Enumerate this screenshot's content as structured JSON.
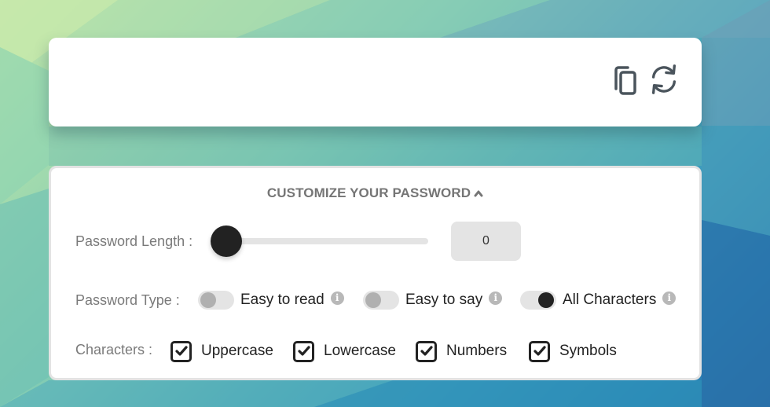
{
  "colors": {
    "accent": "#222222",
    "label": "#7a7a7a",
    "track": "#e4e4e4",
    "card_border": "#e3e3e3",
    "icon": "#4a545c",
    "info_icon": "#b8b8b8"
  },
  "result": {
    "password_value": "",
    "copy_icon": "copy-icon",
    "refresh_icon": "refresh-icon"
  },
  "customize": {
    "title": "CUSTOMIZE YOUR PASSWORD",
    "title_icon": "chevron-up-icon",
    "length": {
      "label": "Password Length :",
      "value": "0",
      "slider_fraction": 0
    },
    "type": {
      "label": "Password Type :",
      "options": [
        {
          "label": "Easy to read",
          "selected": false,
          "info_icon": "info-icon"
        },
        {
          "label": "Easy to say",
          "selected": false,
          "info_icon": "info-icon"
        },
        {
          "label": "All Characters",
          "selected": true,
          "info_icon": "info-icon"
        }
      ]
    },
    "characters": {
      "label": "Characters :",
      "options": [
        {
          "label": "Uppercase",
          "checked": true
        },
        {
          "label": "Lowercase",
          "checked": true
        },
        {
          "label": "Numbers",
          "checked": true
        },
        {
          "label": "Symbols",
          "checked": true
        }
      ]
    }
  }
}
